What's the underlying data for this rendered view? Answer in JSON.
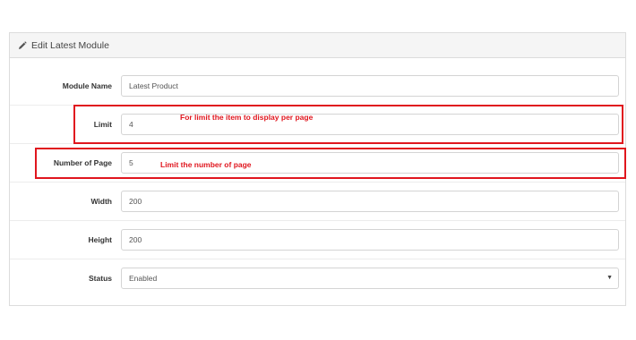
{
  "panel": {
    "title": "Edit Latest Module"
  },
  "form": {
    "module_name": {
      "label": "Module Name",
      "value": "Latest Product"
    },
    "limit": {
      "label": "Limit",
      "value": "4"
    },
    "number_of_page": {
      "label": "Number of Page",
      "value": "5"
    },
    "width": {
      "label": "Width",
      "value": "200"
    },
    "height": {
      "label": "Height",
      "value": "200"
    },
    "status": {
      "label": "Status",
      "value": "Enabled"
    }
  },
  "annotations": {
    "limit_note": "For limit the item to display per page",
    "pages_note": "Limit the number of page"
  },
  "colors": {
    "annotation": "#e0161e"
  },
  "icons": {
    "panel_title": "pencil-icon",
    "status_select": "caret-down-icon"
  }
}
